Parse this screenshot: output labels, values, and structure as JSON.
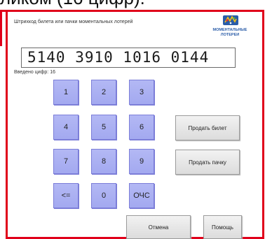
{
  "caption": {
    "visible_text": "ликом (16 цифр)."
  },
  "screen": {
    "title": "Штрихкод билета или пачки моментальных лотерей",
    "barcode_value": "5140 3910 1016 0144",
    "digits_entered": "Введено цифр: 16"
  },
  "logo": {
    "line1": "МОМЕНТАЛЬНЫЕ",
    "line2": "ЛОТЕРЕИ",
    "icon": "instant-lottery-logo-icon"
  },
  "keypad": {
    "k1": "1",
    "k2": "2",
    "k3": "3",
    "k4": "4",
    "k5": "5",
    "k6": "6",
    "k7": "7",
    "k8": "8",
    "k9": "9",
    "backspace": "<=",
    "k0": "0",
    "clear": "ОЧС"
  },
  "actions": {
    "sell_ticket": "Продать билет",
    "sell_pack": "Продать пачку",
    "cancel": "Отмена",
    "help": "Помощь"
  },
  "colors": {
    "frame": "#e0001a",
    "key_fill": "#a9aff2",
    "key_border": "#7c7ed8",
    "logo_blue": "#2a5ca8"
  }
}
